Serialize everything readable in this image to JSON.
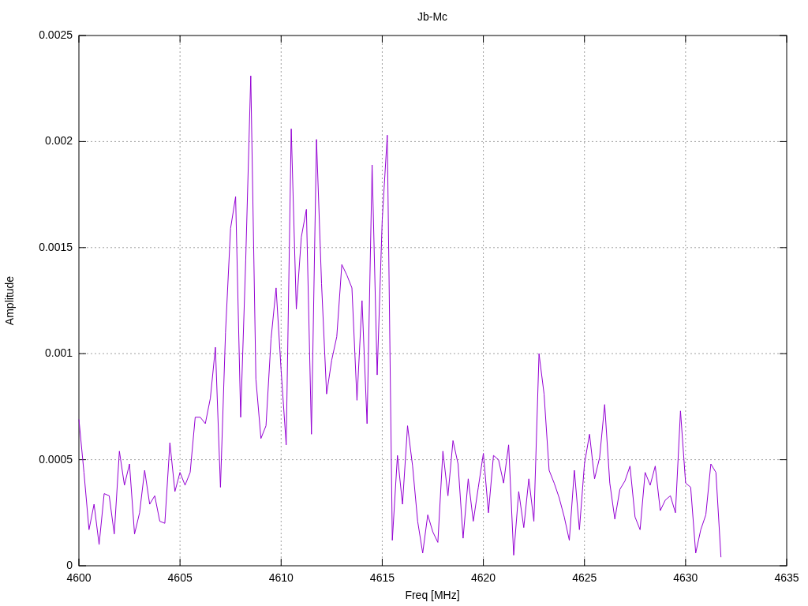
{
  "plot": {
    "chart_data": {
      "type": "line",
      "title": "Jb-Mc",
      "xlabel": "Freq [MHz]",
      "ylabel": "Amplitude",
      "grid": true,
      "xlim": [
        4600,
        4635
      ],
      "ylim": [
        0,
        0.0025
      ],
      "xticks": [
        4600,
        4605,
        4610,
        4615,
        4620,
        4625,
        4630,
        4635
      ],
      "yticks": [
        {
          "value": 0,
          "label": "0"
        },
        {
          "value": 0.0005,
          "label": "0.0005"
        },
        {
          "value": 0.001,
          "label": "0.001"
        },
        {
          "value": 0.0015,
          "label": "0.0015"
        },
        {
          "value": 0.002,
          "label": "0.002"
        },
        {
          "value": 0.0025,
          "label": "0.0025"
        }
      ],
      "x": [
        4600,
        4600.25,
        4600.5,
        4600.75,
        4601,
        4601.25,
        4601.5,
        4601.75,
        4602,
        4602.25,
        4602.5,
        4602.75,
        4603,
        4603.25,
        4603.5,
        4603.75,
        4604,
        4604.25,
        4604.5,
        4604.75,
        4605,
        4605.25,
        4605.5,
        4605.75,
        4606,
        4606.25,
        4606.5,
        4606.75,
        4607,
        4607.25,
        4607.5,
        4607.75,
        4608,
        4608.25,
        4608.5,
        4608.75,
        4609,
        4609.25,
        4609.5,
        4609.75,
        4610,
        4610.25,
        4610.5,
        4610.75,
        4611,
        4611.25,
        4611.5,
        4611.75,
        4612,
        4612.25,
        4612.5,
        4612.75,
        4613,
        4613.25,
        4613.5,
        4613.75,
        4614,
        4614.25,
        4614.5,
        4614.75,
        4615,
        4615.25,
        4615.5,
        4615.75,
        4616,
        4616.25,
        4616.5,
        4616.75,
        4617,
        4617.25,
        4617.5,
        4617.75,
        4618,
        4618.25,
        4618.5,
        4618.75,
        4619,
        4619.25,
        4619.5,
        4619.75,
        4620,
        4620.25,
        4620.5,
        4620.75,
        4621,
        4621.25,
        4621.5,
        4621.75,
        4622,
        4622.25,
        4622.5,
        4622.75,
        4623,
        4623.25,
        4623.5,
        4623.75,
        4624,
        4624.25,
        4624.5,
        4624.75,
        4625,
        4625.25,
        4625.5,
        4625.75,
        4626,
        4626.25,
        4626.5,
        4626.75,
        4627,
        4627.25,
        4627.5,
        4627.75,
        4628,
        4628.25,
        4628.5,
        4628.75,
        4629,
        4629.25,
        4629.5,
        4629.75,
        4630,
        4630.25,
        4630.5,
        4630.75,
        4631,
        4631.25,
        4631.5,
        4631.75
      ],
      "series": [
        {
          "color": "#9400d3",
          "values": [
            0.00069,
            0.00044,
            0.00017,
            0.00029,
            0.0001,
            0.00034,
            0.00033,
            0.00015,
            0.00054,
            0.00038,
            0.00048,
            0.00015,
            0.00025,
            0.00045,
            0.00029,
            0.00033,
            0.00021,
            0.0002,
            0.00058,
            0.00035,
            0.00044,
            0.00038,
            0.00044,
            0.0007,
            0.0007,
            0.00067,
            0.00079,
            0.00103,
            0.00037,
            0.0011,
            0.00159,
            0.00174,
            0.0007,
            0.00144,
            0.00231,
            0.00088,
            0.0006,
            0.00066,
            0.00107,
            0.00131,
            0.00092,
            0.00057,
            0.00206,
            0.00121,
            0.00155,
            0.00168,
            0.00062,
            0.00201,
            0.00133,
            0.00081,
            0.00097,
            0.00108,
            0.00142,
            0.00137,
            0.00131,
            0.00078,
            0.00125,
            0.00067,
            0.00189,
            0.0009,
            0.00163,
            0.00203,
            0.00012,
            0.00052,
            0.00029,
            0.00066,
            0.00047,
            0.00021,
            6e-05,
            0.00024,
            0.00016,
            0.00011,
            0.00054,
            0.00033,
            0.00059,
            0.00048,
            0.00013,
            0.00041,
            0.00021,
            0.00037,
            0.00053,
            0.00025,
            0.00052,
            0.0005,
            0.00039,
            0.00057,
            5e-05,
            0.00035,
            0.00018,
            0.00041,
            0.00021,
            0.001,
            0.00081,
            0.00045,
            0.00039,
            0.00032,
            0.00023,
            0.00012,
            0.00045,
            0.00017,
            0.00048,
            0.00062,
            0.00041,
            0.00051,
            0.00076,
            0.00039,
            0.00022,
            0.00036,
            0.0004,
            0.00047,
            0.00023,
            0.00017,
            0.00044,
            0.00038,
            0.00047,
            0.00026,
            0.00031,
            0.00033,
            0.00025,
            0.00073,
            0.00039,
            0.00037,
            6e-05,
            0.00017,
            0.00024,
            0.00048,
            0.00044,
            4e-05
          ]
        }
      ]
    }
  }
}
